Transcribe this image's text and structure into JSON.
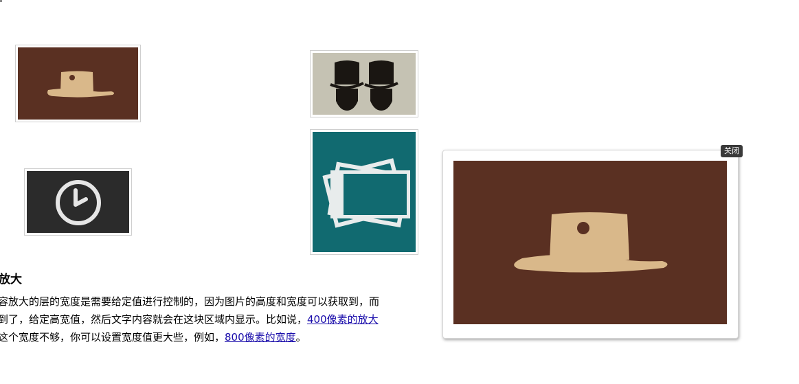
{
  "thumbnails": [
    {
      "name": "thumb-hat",
      "icon": "cowboy-hat-icon",
      "bg": "#5a3022",
      "fg": "#d9b88a"
    },
    {
      "name": "thumb-clock",
      "icon": "clock-icon",
      "bg": "#2b2b2b",
      "fg": "#e6e6e6"
    },
    {
      "name": "thumb-tophats",
      "icon": "top-hats-icon",
      "bg": "#c5c2b3",
      "fg": "#1a1612"
    },
    {
      "name": "thumb-photos",
      "icon": "photos-stack-icon",
      "bg": "#116a70",
      "fg": "#e8ecec"
    }
  ],
  "section": {
    "heading": "放大",
    "line1": "容放大的层的宽度是需要给定值进行控制的，因为图片的高度和宽度可以获取到，而",
    "line2_prefix": "到了，给定高宽值，然后文字内容就会在这块区域内显示。比如说，",
    "link_400": "400像素的放大",
    "line3_prefix": "这个宽度不够，你可以设置宽度值更大些，例如，",
    "link_800": "800像素的宽度",
    "line3_suffix": "。"
  },
  "zoom_layer": {
    "close_label": "关闭",
    "image_icon": "cowboy-hat-icon"
  }
}
